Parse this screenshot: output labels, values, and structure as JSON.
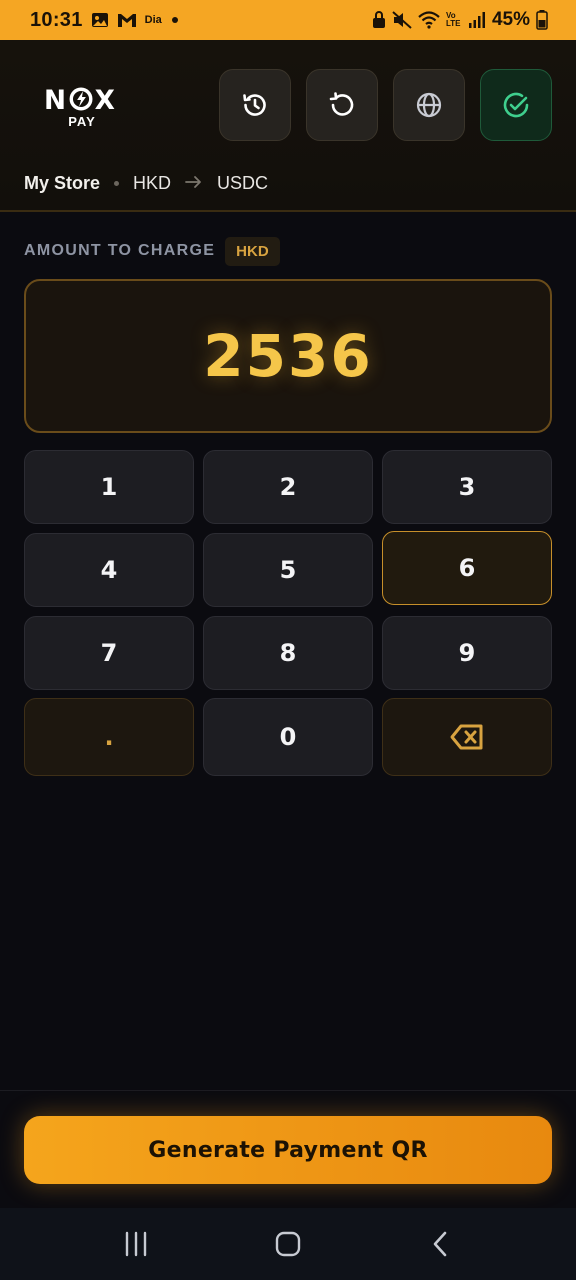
{
  "status_bar": {
    "time": "10:31",
    "carrier_tag": "Dia",
    "network_tag": "Vo LTE",
    "battery": "45%"
  },
  "header": {
    "logo_main": "NOX",
    "logo_sub": "PAY",
    "buttons": [
      {
        "name": "history",
        "icon": "history-icon"
      },
      {
        "name": "refresh",
        "icon": "refresh-icon"
      },
      {
        "name": "language",
        "icon": "globe-icon"
      },
      {
        "name": "confirm",
        "icon": "check-circle-icon"
      }
    ],
    "breadcrumb": {
      "store": "My Store",
      "from_currency": "HKD",
      "to_currency": "USDC"
    }
  },
  "amount": {
    "label": "AMOUNT TO CHARGE",
    "currency": "HKD",
    "value": "2536"
  },
  "keypad": {
    "keys": [
      "1",
      "2",
      "3",
      "4",
      "5",
      "6",
      "7",
      "8",
      "9",
      ".",
      "0",
      "backspace"
    ],
    "active_key": "6"
  },
  "actions": {
    "generate_label": "Generate Payment QR"
  },
  "colors": {
    "accent": "#f5a623",
    "amount": "#f5c64a",
    "success": "#3fcf8e"
  }
}
